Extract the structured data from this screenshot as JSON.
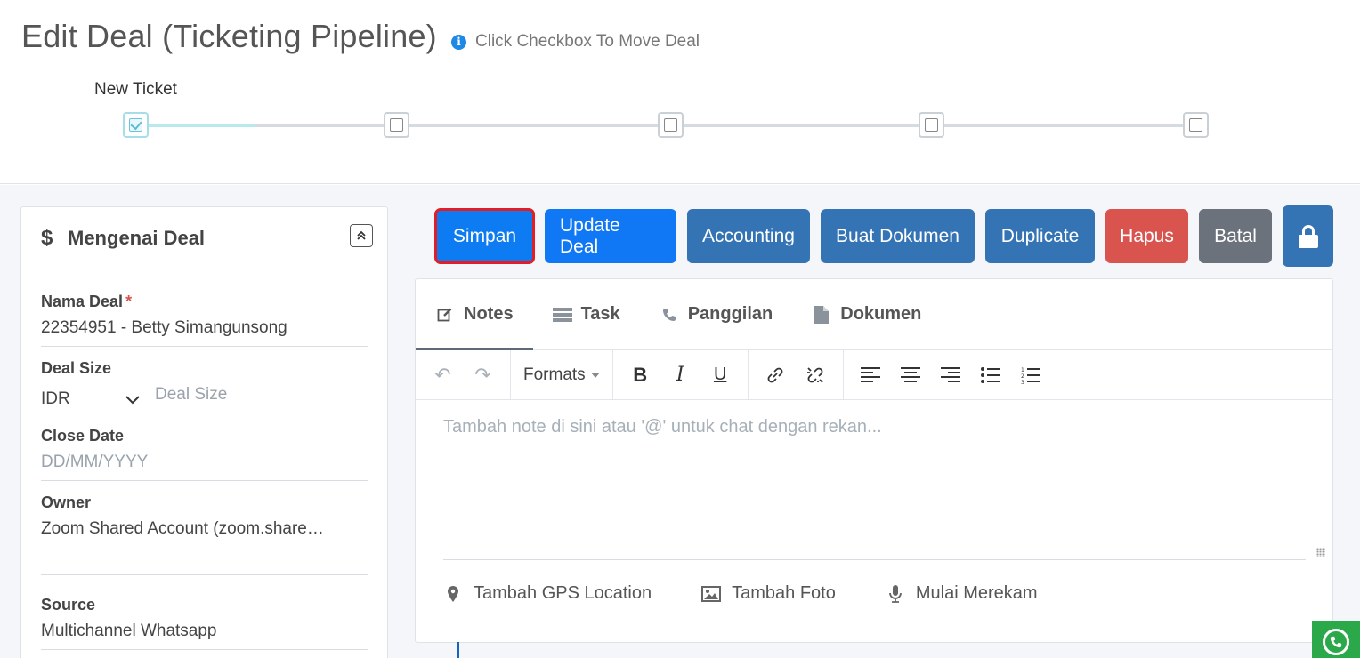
{
  "header": {
    "title": "Edit Deal (Ticketing Pipeline)",
    "hint": "Click Checkbox To Move Deal"
  },
  "pipeline": {
    "current_stage_label": "New Ticket",
    "stages": [
      {
        "checked": true
      },
      {
        "checked": false
      },
      {
        "checked": false
      },
      {
        "checked": false
      },
      {
        "checked": false
      }
    ]
  },
  "deal_panel": {
    "title": "Mengenai Deal",
    "fields": {
      "nama_deal": {
        "label": "Nama Deal",
        "required_mark": "*",
        "value": "22354951 - Betty Simangunsong"
      },
      "deal_size": {
        "label": "Deal Size",
        "currency": "IDR",
        "placeholder": "Deal Size"
      },
      "close_date": {
        "label": "Close Date",
        "placeholder": "DD/MM/YYYY"
      },
      "owner": {
        "label": "Owner",
        "value": "Zoom Shared Account (zoom.share…"
      },
      "source": {
        "label": "Source",
        "value": "Multichannel Whatsapp"
      }
    }
  },
  "actions": {
    "simpan": "Simpan",
    "update_deal": "Update Deal",
    "accounting": "Accounting",
    "buat_dokumen": "Buat Dokumen",
    "duplicate": "Duplicate",
    "hapus": "Hapus",
    "batal": "Batal"
  },
  "notes_panel": {
    "tabs": [
      {
        "label": "Notes",
        "icon": "edit-icon",
        "active": true
      },
      {
        "label": "Task",
        "icon": "tasks-icon",
        "active": false
      },
      {
        "label": "Panggilan",
        "icon": "phone-icon",
        "active": false
      },
      {
        "label": "Dokumen",
        "icon": "file-icon",
        "active": false
      }
    ],
    "toolbar": {
      "formats_label": "Formats"
    },
    "editor_placeholder": "Tambah note di sini atau '@' untuk chat dengan rekan...",
    "attachments": {
      "gps": "Tambah GPS Location",
      "foto": "Tambah Foto",
      "rekam": "Mulai Merekam"
    }
  },
  "colors": {
    "primary": "#1178f5",
    "steel": "#3474b4",
    "danger": "#d9534f",
    "secondary": "#6c727c",
    "highlight_outline": "#e21d24",
    "whatsapp": "#2aa84a"
  }
}
